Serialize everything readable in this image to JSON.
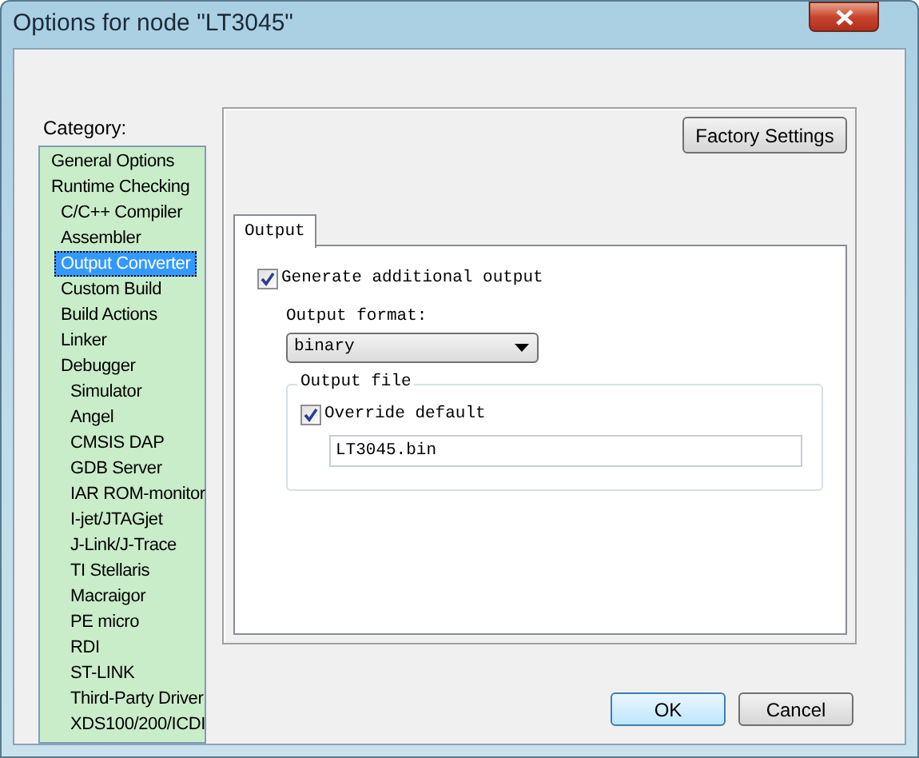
{
  "window": {
    "title": "Options for node \"LT3045\""
  },
  "category_label": "Category:",
  "categories": [
    {
      "label": "General Options",
      "selected": false
    },
    {
      "label": "Runtime Checking",
      "selected": false,
      "children": [
        {
          "label": "C/C++ Compiler",
          "selected": false
        },
        {
          "label": "Assembler",
          "selected": false
        },
        {
          "label": "Output Converter",
          "selected": true
        },
        {
          "label": "Custom Build",
          "selected": false
        },
        {
          "label": "Build Actions",
          "selected": false
        },
        {
          "label": "Linker",
          "selected": false
        },
        {
          "label": "Debugger",
          "selected": false,
          "children": [
            {
              "label": "Simulator",
              "selected": false
            },
            {
              "label": "Angel",
              "selected": false
            },
            {
              "label": "CMSIS DAP",
              "selected": false
            },
            {
              "label": "GDB Server",
              "selected": false
            },
            {
              "label": "IAR ROM-monitor",
              "selected": false
            },
            {
              "label": "I-jet/JTAGjet",
              "selected": false
            },
            {
              "label": "J-Link/J-Trace",
              "selected": false
            },
            {
              "label": "TI Stellaris",
              "selected": false
            },
            {
              "label": "Macraigor",
              "selected": false
            },
            {
              "label": "PE micro",
              "selected": false
            },
            {
              "label": "RDI",
              "selected": false
            },
            {
              "label": "ST-LINK",
              "selected": false
            },
            {
              "label": "Third-Party Driver",
              "selected": false
            },
            {
              "label": "XDS100/200/ICDI",
              "selected": false
            }
          ]
        }
      ]
    }
  ],
  "factory_settings_button": "Factory Settings",
  "tabs": [
    {
      "label": "Output",
      "selected": true
    }
  ],
  "generate_output": {
    "label": "Generate additional output",
    "checked": true
  },
  "output_format": {
    "label": "Output format:",
    "value": "binary"
  },
  "output_file": {
    "legend": "Output file",
    "override": {
      "label": "Override default",
      "checked": true
    },
    "value": "LT3045.bin"
  },
  "buttons": [
    {
      "label": "OK",
      "kind": "default"
    },
    {
      "label": "Cancel",
      "kind": "normal"
    }
  ]
}
